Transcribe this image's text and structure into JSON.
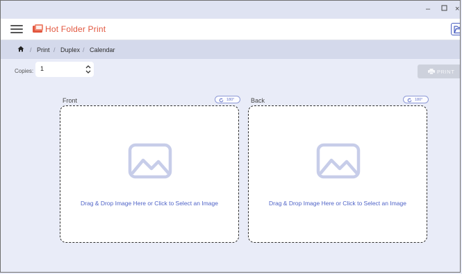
{
  "window": {
    "minimize_glyph": "–",
    "maximize_glyph": "⚲",
    "close_glyph": "×"
  },
  "app": {
    "title": "Hot Folder Print",
    "accent": "#e2573f",
    "primary": "#4f63c7"
  },
  "breadcrumb": {
    "items": [
      "Print",
      "Duplex",
      "Calendar"
    ],
    "separator": "/"
  },
  "copies": {
    "label": "Copies:",
    "value": "1"
  },
  "print_button": {
    "label": "PRINT",
    "enabled": false
  },
  "panels": {
    "front": {
      "title": "Front",
      "rotate_label": "180°",
      "drop_text": "Drag & Drop Image Here or Click to Select an Image"
    },
    "back": {
      "title": "Back",
      "rotate_label": "180°",
      "drop_text": "Drag & Drop Image Here or Click to Select an Image"
    }
  },
  "icons": [
    "hamburger-menu-icon",
    "app-logo-icon",
    "folder-open-icon",
    "home-icon",
    "stepper-icon",
    "printer-icon",
    "rotate-icon",
    "image-placeholder-icon"
  ]
}
